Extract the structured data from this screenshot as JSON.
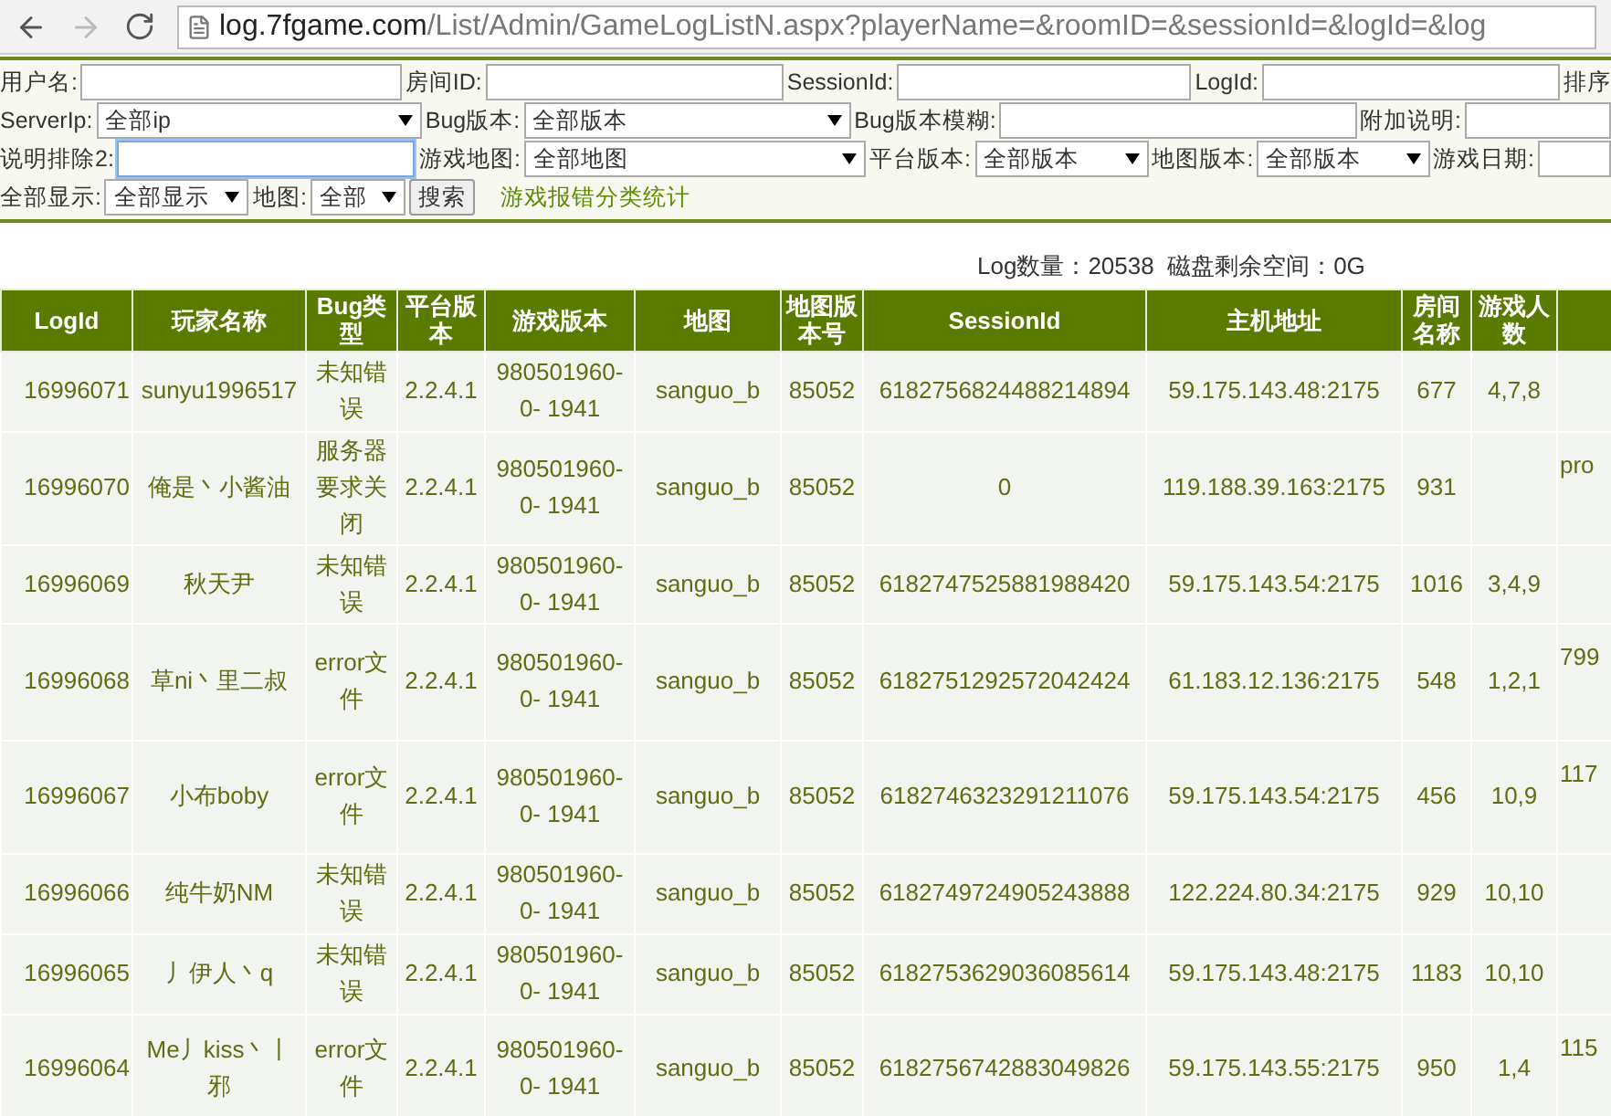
{
  "browser": {
    "url_domain": "log.7fgame.com",
    "url_path": "/List/Admin/GameLogListN.aspx?playerName=&roomID=&sessionId=&logId=&log"
  },
  "form": {
    "lines": [
      [
        {
          "kind": "label",
          "text": "用户名:"
        },
        {
          "kind": "input"
        },
        {
          "kind": "label",
          "text": "房间ID:"
        },
        {
          "kind": "input"
        },
        {
          "kind": "label",
          "text": "SessionId:"
        },
        {
          "kind": "input"
        },
        {
          "kind": "label",
          "text": "LogId:"
        },
        {
          "kind": "input"
        },
        {
          "kind": "label",
          "text": "排序"
        }
      ],
      [
        {
          "kind": "label",
          "text": "ServerIp:"
        },
        {
          "kind": "select",
          "value": "全部ip"
        },
        {
          "kind": "label",
          "text": "Bug版本:"
        },
        {
          "kind": "select",
          "value": "全部版本"
        },
        {
          "kind": "label",
          "text": "Bug版本模糊:"
        },
        {
          "kind": "input"
        },
        {
          "kind": "label",
          "text": "附加说明:"
        },
        {
          "kind": "input"
        }
      ],
      [
        {
          "kind": "label",
          "text": "说明排除2:"
        },
        {
          "kind": "input",
          "focused": true
        },
        {
          "kind": "label",
          "text": "游戏地图:"
        },
        {
          "kind": "select",
          "value": "全部地图"
        },
        {
          "kind": "label",
          "text": "平台版本:"
        },
        {
          "kind": "select",
          "value": "全部版本"
        },
        {
          "kind": "label",
          "text": "地图版本:"
        },
        {
          "kind": "select",
          "value": "全部版本"
        },
        {
          "kind": "label",
          "text": "游戏日期:"
        },
        {
          "kind": "input"
        }
      ],
      [
        {
          "kind": "label",
          "text": "全部显示:"
        },
        {
          "kind": "select",
          "value": "全部显示"
        },
        {
          "kind": "label",
          "text": "地图:"
        },
        {
          "kind": "select",
          "value": "全部"
        },
        {
          "kind": "button",
          "text": "搜索"
        },
        {
          "kind": "link",
          "text": "游戏报错分类统计"
        }
      ]
    ]
  },
  "summary": "Log数量：20538  磁盘剩余空间：0G",
  "table": {
    "columns": [
      {
        "label": "LogId"
      },
      {
        "label": "玩家名称"
      },
      {
        "label": "Bug类型"
      },
      {
        "label": "平台版本"
      },
      {
        "label": "游戏版本"
      },
      {
        "label": "地图"
      },
      {
        "label": "地图版本号"
      },
      {
        "label": "SessionId"
      },
      {
        "label": "主机地址"
      },
      {
        "label": "房间名称"
      },
      {
        "label": "游戏人数"
      },
      {}
    ],
    "rows": [
      [
        "16996071",
        "sunyu1996517",
        "未知错误",
        "2.2.4.1",
        "980501960-0- 1941",
        "sanguo_b",
        "85052",
        "6182756824488214894",
        "59.175.143.48:2175",
        "677",
        "4,7,8",
        ""
      ],
      [
        "16996070",
        "俺是丶小酱油",
        "服务器要求关闭",
        "2.2.4.1",
        "980501960-0- 1941",
        "sanguo_b",
        "85052",
        "0",
        "119.188.39.163:2175",
        "931",
        "",
        "pro"
      ],
      [
        "16996069",
        "秋天尹",
        "未知错误",
        "2.2.4.1",
        "980501960-0- 1941",
        "sanguo_b",
        "85052",
        "6182747525881988420",
        "59.175.143.54:2175",
        "1016",
        "3,4,9",
        ""
      ],
      [
        "16996068",
        "草ni丶里二叔",
        "error文件",
        "2.2.4.1",
        "980501960-0- 1941",
        "sanguo_b",
        "85052",
        "6182751292572042424",
        "61.183.12.136:2175",
        "548",
        "1,2,1",
        "799"
      ],
      [
        "16996067",
        "小布boby",
        "error文件",
        "2.2.4.1",
        "980501960-0- 1941",
        "sanguo_b",
        "85052",
        "6182746323291211076",
        "59.175.143.54:2175",
        "456",
        "10,9",
        "117"
      ],
      [
        "16996066",
        "纯牛奶NM",
        "未知错误",
        "2.2.4.1",
        "980501960-0- 1941",
        "sanguo_b",
        "85052",
        "6182749724905243888",
        "122.224.80.34:2175",
        "929",
        "10,10",
        ""
      ],
      [
        "16996065",
        "丿伊人丶q",
        "未知错误",
        "2.2.4.1",
        "980501960-0- 1941",
        "sanguo_b",
        "85052",
        "6182753629036085614",
        "59.175.143.48:2175",
        "1183",
        "10,10",
        ""
      ],
      [
        "16996064",
        "Me丿kiss丶丨邪",
        "error文件",
        "2.2.4.1",
        "980501960-0- 1941",
        "sanguo_b",
        "85052",
        "6182756742883049826",
        "59.175.143.55:2175",
        "950",
        "1,4",
        "115"
      ]
    ]
  }
}
